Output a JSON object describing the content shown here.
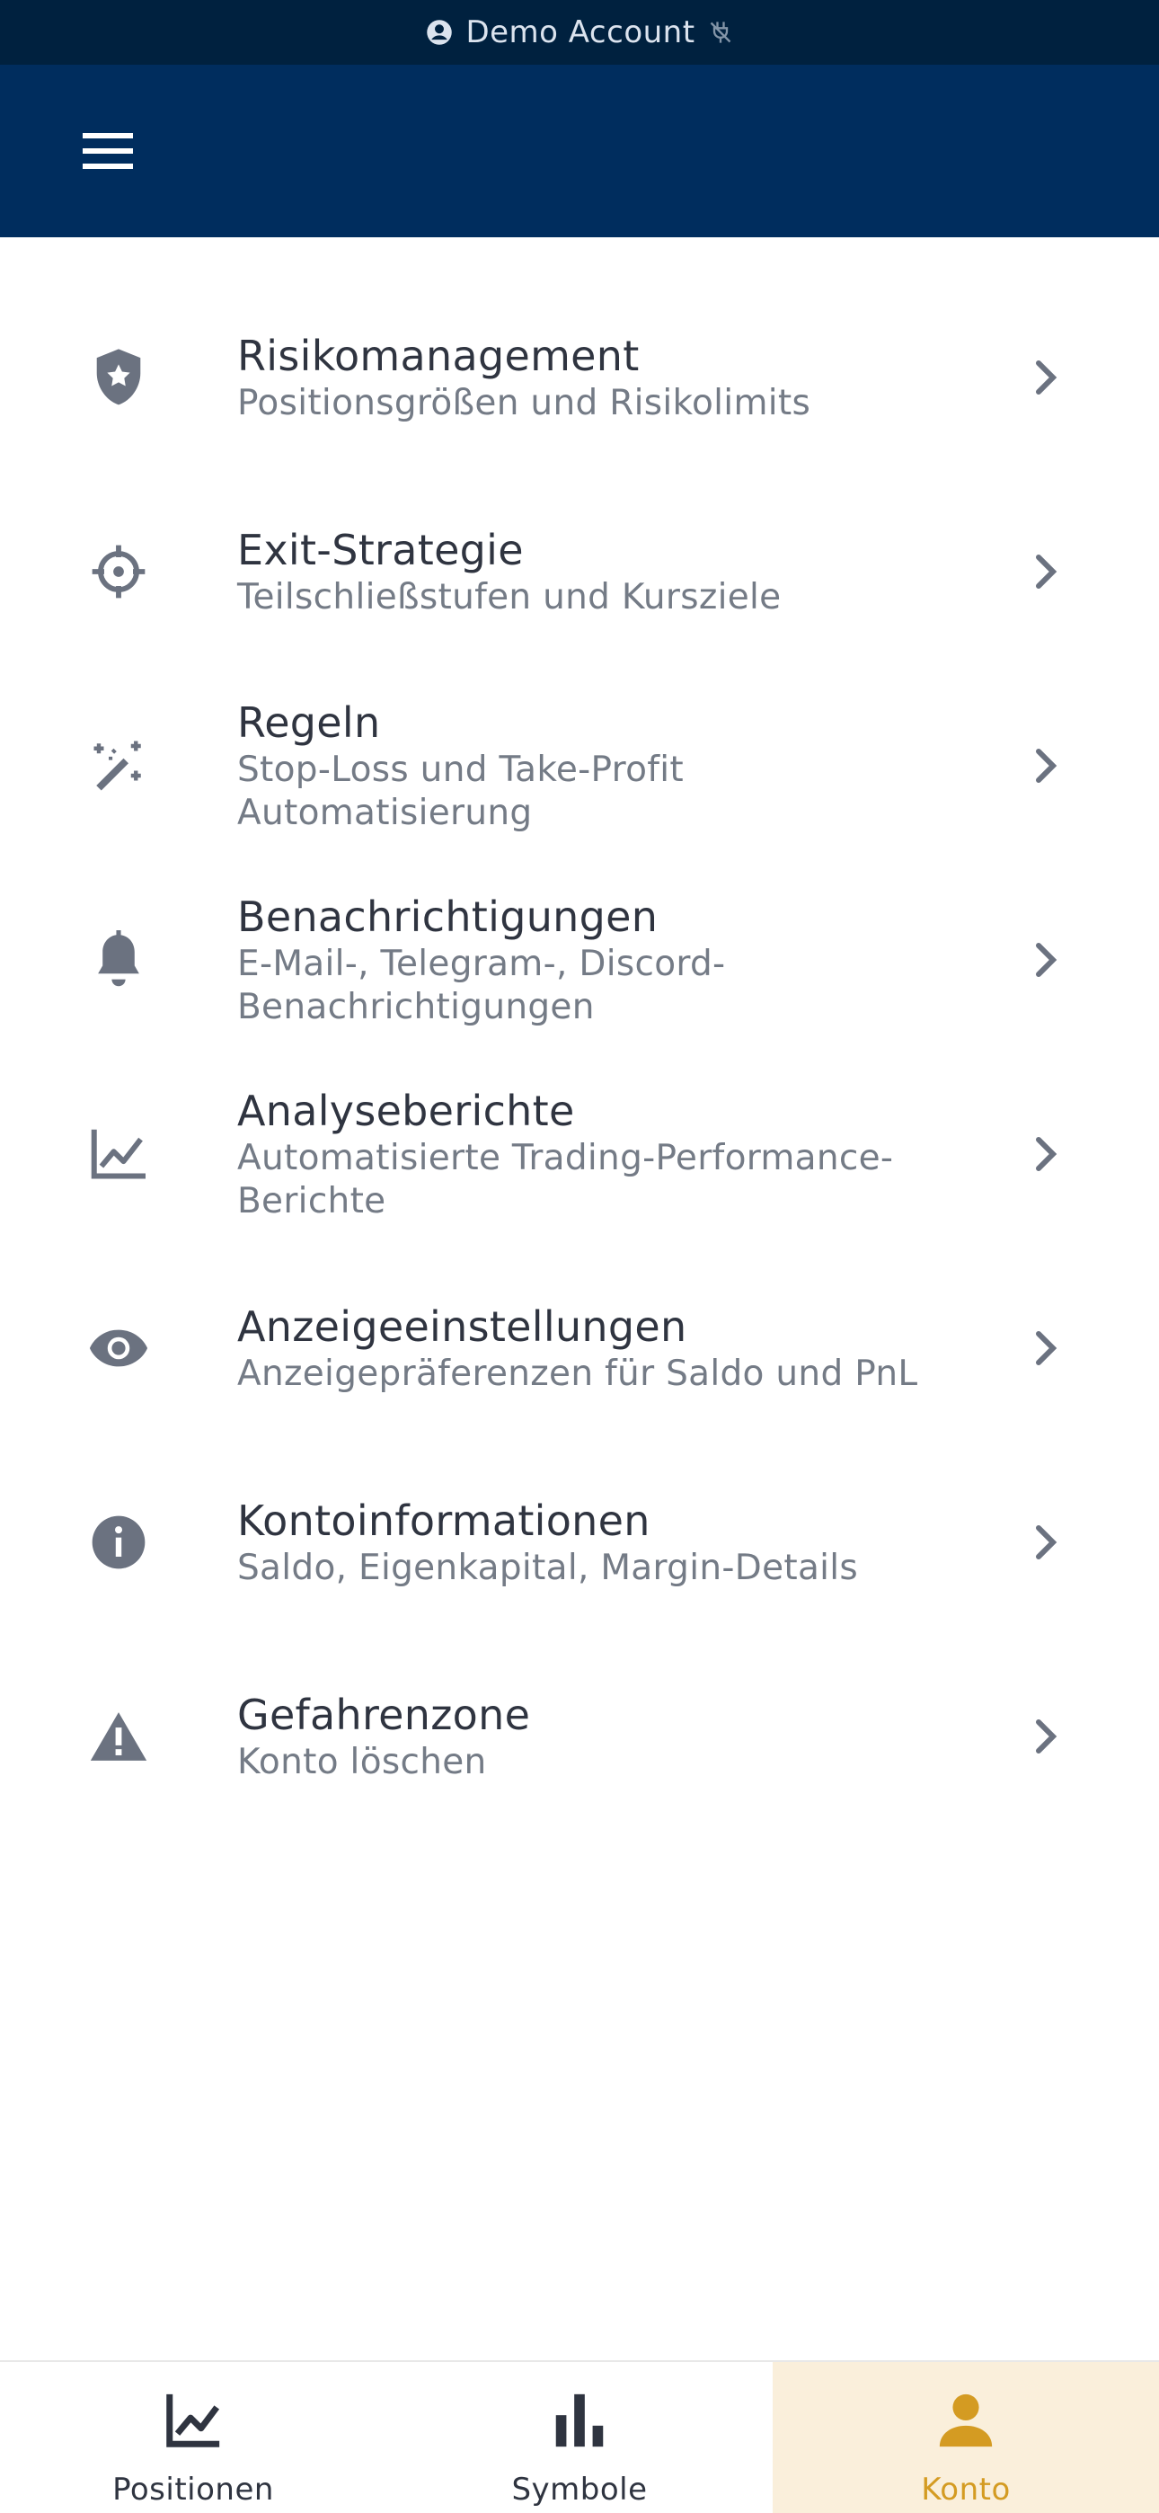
{
  "account_strip": {
    "label": "Demo Account",
    "icons": [
      "account-circle-icon",
      "plug-off-icon"
    ]
  },
  "appbar": {
    "menu_icon": "hamburger-menu-icon"
  },
  "menu": {
    "items": [
      {
        "title": "Risikomanagement",
        "subtitle": "Positionsgrößen und Risikolimits",
        "icon": "shield-star-icon"
      },
      {
        "title": "Exit-Strategie",
        "subtitle": "Teilschließstufen und Kursziele",
        "icon": "crosshair-icon"
      },
      {
        "title": "Regeln",
        "subtitle": "Stop-Loss und Take-Profit Automatisierung",
        "icon": "magic-wand-icon"
      },
      {
        "title": "Benachrichtigungen",
        "subtitle": "E-Mail-, Telegram-, Discord-Benachrichtigungen",
        "icon": "bell-icon"
      },
      {
        "title": "Analyseberichte",
        "subtitle": "Automatisierte Trading-Performance-Berichte",
        "icon": "line-chart-icon"
      },
      {
        "title": "Anzeigeeinstellungen",
        "subtitle": "Anzeigepräferenzen für Saldo und PnL",
        "icon": "eye-icon"
      },
      {
        "title": "Kontoinformationen",
        "subtitle": "Saldo, Eigenkapital, Margin-Details",
        "icon": "info-icon"
      },
      {
        "title": "Gefahrenzone",
        "subtitle": "Konto löschen",
        "icon": "warning-icon"
      }
    ]
  },
  "bottom_nav": {
    "tabs": [
      {
        "label": "Positionen",
        "icon": "line-chart-icon",
        "active": false
      },
      {
        "label": "Symbole",
        "icon": "bar-chart-icon",
        "active": false
      },
      {
        "label": "Konto",
        "icon": "person-icon",
        "active": true
      }
    ]
  },
  "colors": {
    "strip_bg": "#00213f",
    "appbar_bg": "#002d5e",
    "icon_gray": "#6b7280",
    "active_tab_bg": "#faefdb",
    "active_tab_fg": "#d49b22"
  }
}
